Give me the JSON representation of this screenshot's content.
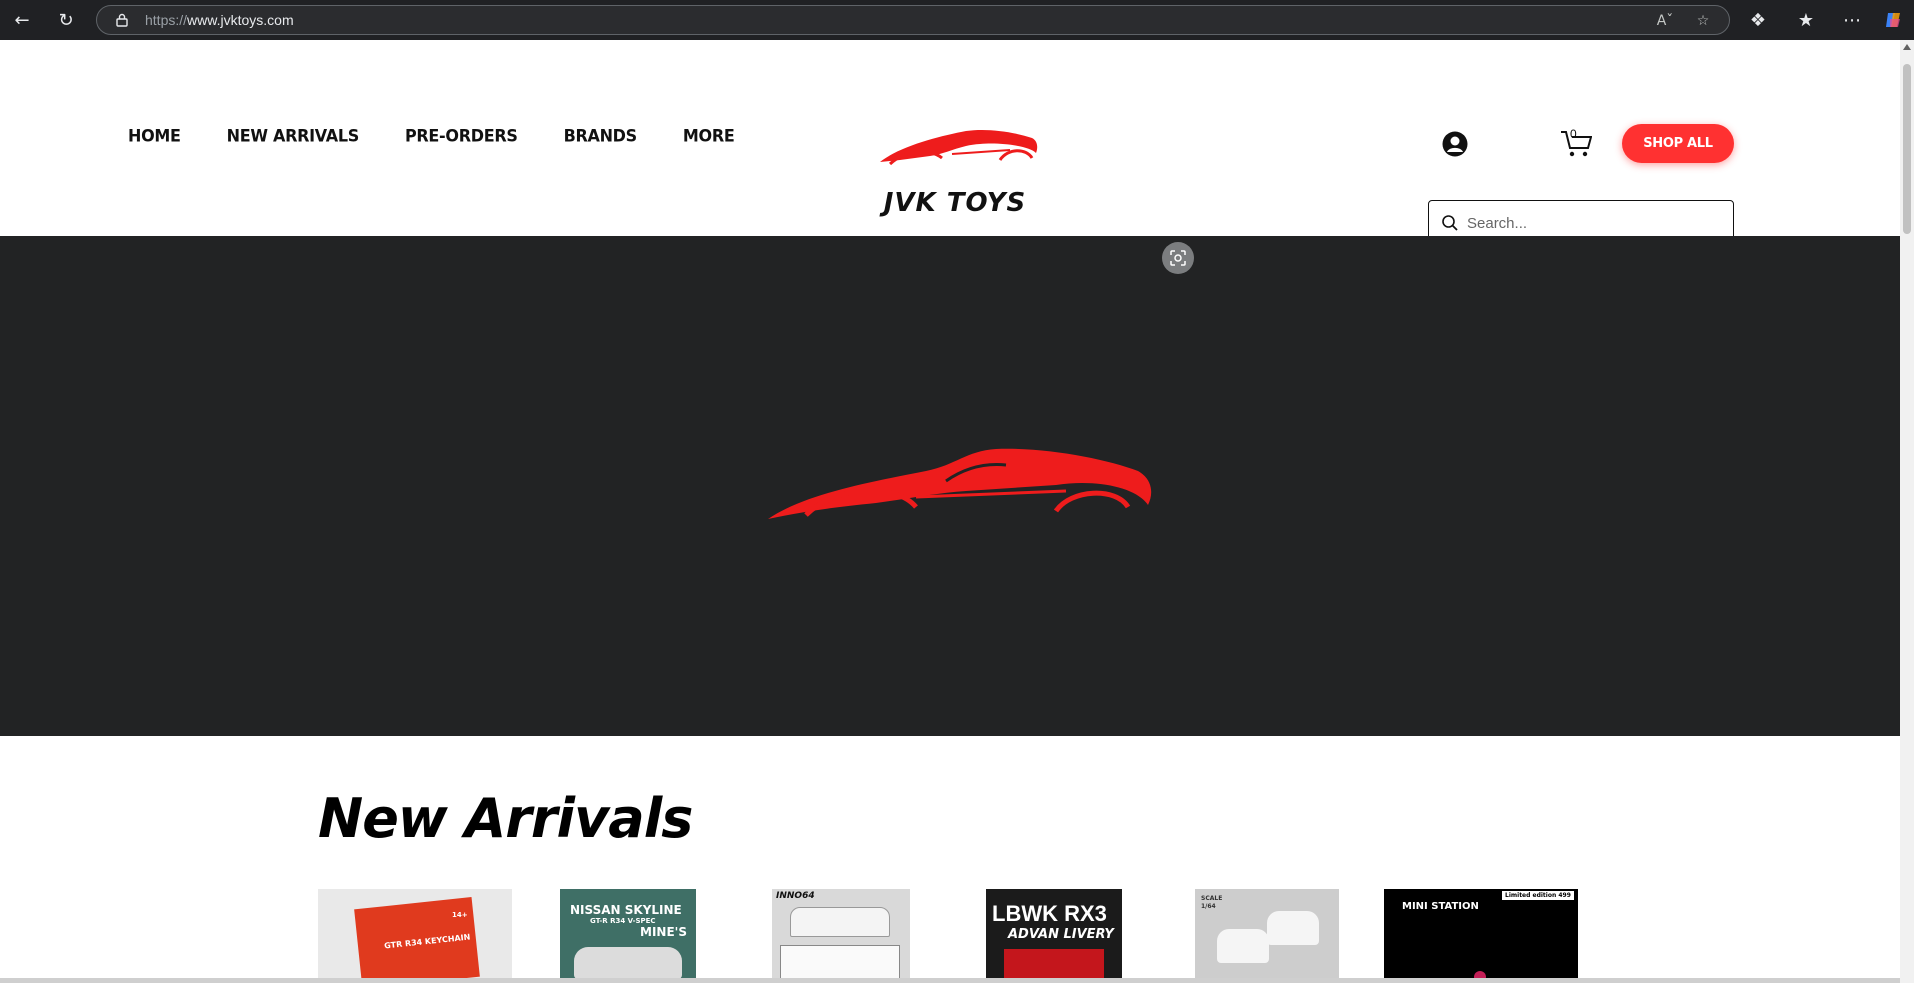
{
  "browser": {
    "url_scheme": "https://",
    "url_host": "www.jvktoys.com"
  },
  "nav": {
    "items": [
      "HOME",
      "NEW ARRIVALS",
      "PRE-ORDERS",
      "BRANDS",
      "MORE"
    ]
  },
  "logo": {
    "text": "JVK TOYS"
  },
  "cart": {
    "count": "0"
  },
  "header": {
    "shop_all_label": "SHOP ALL"
  },
  "search": {
    "placeholder": "Search..."
  },
  "section": {
    "title": "New Arrivals"
  },
  "products": [
    {
      "label": "GTR R34 KEYCHAIN",
      "badge": "14+"
    },
    {
      "label": "NISSAN SKYLINE",
      "sub": "GT-R R34 V-SPEC",
      "extra": "MINE'S"
    },
    {
      "label": "INNO64"
    },
    {
      "label": "LBWK RX3",
      "sub": "ADVAN LIVERY"
    },
    {
      "label": "SCALE",
      "sub": "1/64"
    },
    {
      "label": "MINI STATION",
      "sub": "Limited edition 499"
    }
  ],
  "colors": {
    "brand_red": "#ff3131",
    "hero_bg": "#222324",
    "chrome_bg": "#202124"
  }
}
